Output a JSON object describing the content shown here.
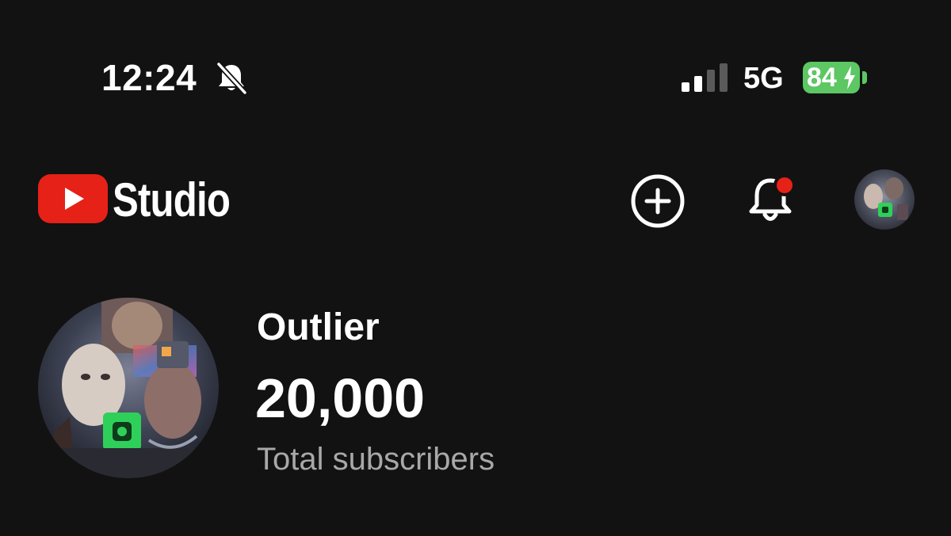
{
  "status_bar": {
    "time": "12:24",
    "silent_icon": "bell-slash-icon",
    "signal_icon": "cellular-signal-icon",
    "network": "5G",
    "battery_level": "84",
    "battery_percent": 84,
    "battery_charging": true,
    "battery_color": "#5cc763"
  },
  "header": {
    "app_name": "Studio",
    "logo_icon": "youtube-logo-icon",
    "logo_color": "#e62117",
    "create_icon": "plus-circle-icon",
    "notifications_icon": "bell-icon",
    "notification_dot_color": "#e62117"
  },
  "channel": {
    "name": "Outlier",
    "subscriber_count": "20,000",
    "subscriber_label": "Total subscribers"
  }
}
